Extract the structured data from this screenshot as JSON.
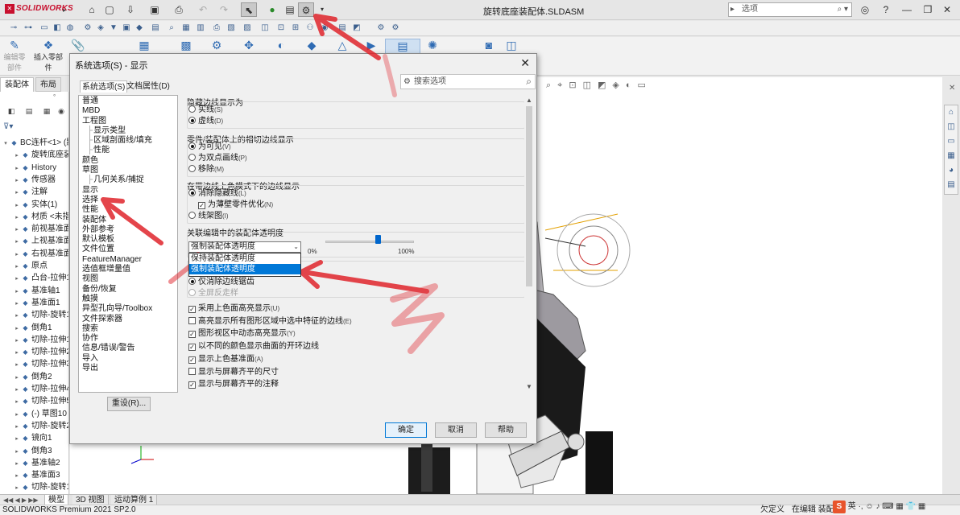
{
  "app": {
    "logo_text": "SOLIDWORKS",
    "document_title": "旋转底座装配体.SLDASM",
    "search_placeholder": "选项"
  },
  "ribbon": {
    "items": [
      "编辑零部件",
      "插入零部件",
      "配合",
      "零部件预览窗口",
      "线性零部件阵列",
      "智能扣件",
      "移动零部件",
      "显示隐藏的零部件",
      "装配体特征",
      "参考几何体",
      "新建运动算例",
      "材料明细表",
      "爆炸视图",
      "Instant3D",
      "更新Speedpak",
      "拍快照",
      "大型装配体模式"
    ]
  },
  "left_panel": {
    "tabs": [
      "装配体",
      "布局"
    ],
    "tree": [
      {
        "label": "BC连杆<1> (默认<默认_显示状态-1>)",
        "icon": "assembly-icon",
        "level": 0
      },
      {
        "label": "旋转底座装配体",
        "icon": "part-icon",
        "level": 1
      },
      {
        "label": "History",
        "icon": "history-icon",
        "level": 1
      },
      {
        "label": "传感器",
        "icon": "sensor-icon",
        "level": 1
      },
      {
        "label": "注解",
        "icon": "annotation-icon",
        "level": 1
      },
      {
        "label": "实体(1)",
        "icon": "solid-body-icon",
        "level": 1
      },
      {
        "label": "材质 <未指定>",
        "icon": "material-icon",
        "level": 1
      },
      {
        "label": "前视基准面",
        "icon": "plane-icon",
        "level": 1
      },
      {
        "label": "上视基准面",
        "icon": "plane-icon",
        "level": 1
      },
      {
        "label": "右视基准面",
        "icon": "plane-icon",
        "level": 1
      },
      {
        "label": "原点",
        "icon": "origin-icon",
        "level": 1
      },
      {
        "label": "凸台-拉伸1",
        "icon": "extrude-icon",
        "level": 1
      },
      {
        "label": "基准轴1",
        "icon": "axis-icon",
        "level": 1
      },
      {
        "label": "基准面1",
        "icon": "plane-icon",
        "level": 1
      },
      {
        "label": "切除-旋转1",
        "icon": "cut-revolve-icon",
        "level": 1
      },
      {
        "label": "倒角1",
        "icon": "chamfer-icon",
        "level": 1
      },
      {
        "label": "切除-拉伸1",
        "icon": "cut-extrude-icon",
        "level": 1
      },
      {
        "label": "切除-拉伸2",
        "icon": "cut-extrude-icon",
        "level": 1
      },
      {
        "label": "切除-拉伸3",
        "icon": "cut-extrude-icon",
        "level": 1
      },
      {
        "label": "倒角2",
        "icon": "chamfer-icon",
        "level": 1
      },
      {
        "label": "切除-拉伸4",
        "icon": "cut-extrude-icon",
        "level": 1
      },
      {
        "label": "切除-拉伸5",
        "icon": "cut-extrude-icon",
        "level": 1
      },
      {
        "label": "(-) 草图10",
        "icon": "sketch-icon",
        "level": 1
      },
      {
        "label": "切除-旋转2",
        "icon": "cut-revolve-icon",
        "level": 1
      },
      {
        "label": "镜向1",
        "icon": "mirror-icon",
        "level": 1
      },
      {
        "label": "倒角3",
        "icon": "chamfer-icon",
        "level": 1
      },
      {
        "label": "基准轴2",
        "icon": "axis-icon",
        "level": 1
      },
      {
        "label": "基准面3",
        "icon": "plane-icon",
        "level": 1
      },
      {
        "label": "切除-旋转11 ->{->}",
        "icon": "cut-revolve-icon",
        "level": 1
      }
    ]
  },
  "bottom": {
    "tabs": [
      "模型",
      "3D 视图",
      "运动算例 1"
    ],
    "status_left": "SOLIDWORKS Premium 2021 SP2.0",
    "status_mid": "欠定义",
    "status_right": "在编辑 装配体",
    "ime_label": "英"
  },
  "dialog": {
    "title": "系统选项(S) - 显示",
    "tabs": [
      "系统选项(S)",
      "文档属性(D)"
    ],
    "search_placeholder": "搜索选项",
    "categories": [
      {
        "label": "普通",
        "sub": false
      },
      {
        "label": "MBD",
        "sub": false
      },
      {
        "label": "工程图",
        "sub": false
      },
      {
        "label": "显示类型",
        "sub": true
      },
      {
        "label": "区域剖面线/填充",
        "sub": true
      },
      {
        "label": "性能",
        "sub": true
      },
      {
        "label": "颜色",
        "sub": false
      },
      {
        "label": "草图",
        "sub": false
      },
      {
        "label": "几何关系/捕捉",
        "sub": true
      },
      {
        "label": "显示",
        "sub": false
      },
      {
        "label": "选择",
        "sub": false
      },
      {
        "label": "性能",
        "sub": false
      },
      {
        "label": "装配体",
        "sub": false
      },
      {
        "label": "外部参考",
        "sub": false
      },
      {
        "label": "默认模板",
        "sub": false
      },
      {
        "label": "文件位置",
        "sub": false
      },
      {
        "label": "FeatureManager",
        "sub": false
      },
      {
        "label": "选值框增量值",
        "sub": false
      },
      {
        "label": "视图",
        "sub": false
      },
      {
        "label": "备份/恢复",
        "sub": false
      },
      {
        "label": "触摸",
        "sub": false
      },
      {
        "label": "异型孔向导/Toolbox",
        "sub": false
      },
      {
        "label": "文件探索器",
        "sub": false
      },
      {
        "label": "搜索",
        "sub": false
      },
      {
        "label": "协作",
        "sub": false
      },
      {
        "label": "信息/错误/警告",
        "sub": false
      },
      {
        "label": "导入",
        "sub": false
      },
      {
        "label": "导出",
        "sub": false
      }
    ],
    "reset_label": "重设(R)...",
    "groups": {
      "hidden_edges": {
        "title": "隐藏边线显示为",
        "options": [
          {
            "label": "实线",
            "key": "(S)"
          },
          {
            "label": "虚线",
            "key": "(D)"
          }
        ],
        "selected": 1
      },
      "tangent_edges": {
        "title": "零件/装配体上的相切边线显示",
        "options": [
          {
            "label": "为可见",
            "key": "(V)"
          },
          {
            "label": "为双点画线",
            "key": "(P)"
          },
          {
            "label": "移除",
            "key": "(M)"
          }
        ],
        "selected": 0
      },
      "shaded_edges": {
        "title": "在带边线上色模式下的边线显示",
        "options": [
          {
            "label": "消除隐藏线",
            "key": "(L)"
          },
          {
            "label": "线架图",
            "key": "(I)"
          }
        ],
        "selected": 0,
        "sub_check": {
          "label": "为薄壁零件优化",
          "key": "(N)",
          "checked": true
        }
      },
      "transparency": {
        "title": "关联编辑中的装配体透明度",
        "select_value": "强制装配体透明度",
        "dropdown_options": [
          "保持装配体透明度",
          "强制装配体透明度"
        ],
        "highlighted_option": 1,
        "slider_value": 60,
        "slider_min_label": "0%",
        "slider_max_label": "100%"
      },
      "antialias": {
        "options": [
          {
            "label": "仅消除边线锯齿",
            "key": ""
          },
          {
            "label": "全屏反走样",
            "key": ""
          }
        ]
      }
    },
    "checkboxes": [
      {
        "label": "采用上色面高亮显示",
        "key": "(U)",
        "checked": true
      },
      {
        "label": "高亮显示所有图形区域中选中特征的边线",
        "key": "(E)",
        "checked": false
      },
      {
        "label": "图形视区中动态高亮显示",
        "key": "(Y)",
        "checked": true
      },
      {
        "label": "以不同的颜色显示曲面的开环边线",
        "key": "",
        "checked": true
      },
      {
        "label": "显示上色基准面",
        "key": "(A)",
        "checked": true
      },
      {
        "label": "显示与屏幕齐平的尺寸",
        "key": "",
        "checked": false
      },
      {
        "label": "显示与屏幕齐平的注释",
        "key": "",
        "checked": true
      }
    ],
    "buttons": {
      "ok": "确定",
      "cancel": "取消",
      "help": "帮助"
    }
  },
  "annotations": {
    "stroke_color": "#e0242b"
  }
}
